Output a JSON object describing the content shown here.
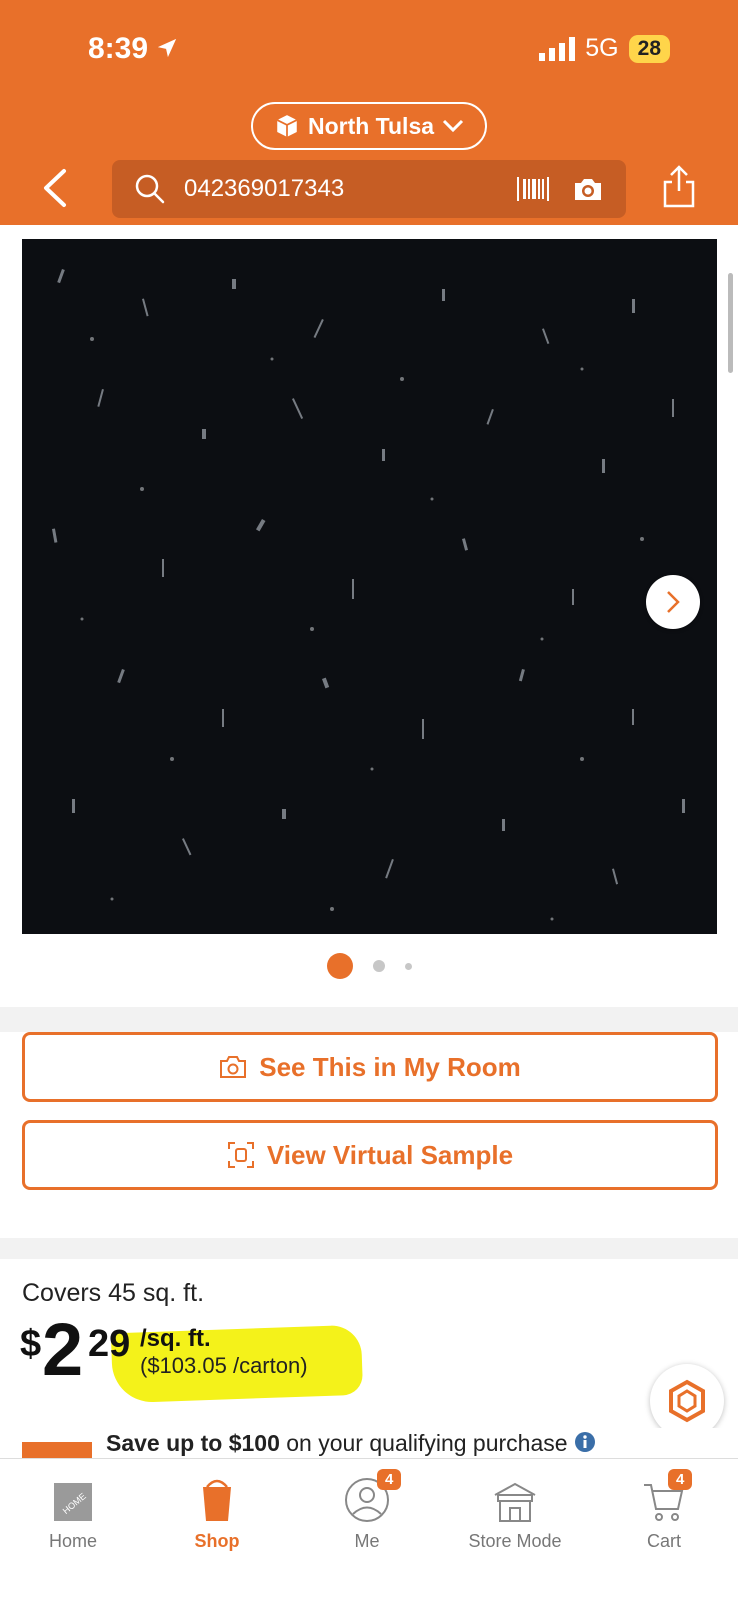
{
  "status": {
    "time": "8:39",
    "network": "5G",
    "battery": "28"
  },
  "header": {
    "store": "North Tulsa",
    "search_value": "042369017343"
  },
  "gallery": {
    "dot_count": 3,
    "active_index": 0
  },
  "actions": {
    "see_in_room": "See This in My Room",
    "virtual_sample": "View Virtual Sample"
  },
  "pricing": {
    "covers": "Covers 45 sq. ft.",
    "currency": "$",
    "dollars": "2",
    "cents": "29",
    "unit": "/sq. ft.",
    "carton": "($103.05 /carton)"
  },
  "promo": {
    "bold": "Save up to $100",
    "rest": " on your qualifying purchase"
  },
  "tabs": [
    {
      "label": "Home",
      "icon": "home-depot-logo-icon"
    },
    {
      "label": "Shop",
      "icon": "shop-bucket-icon",
      "active": true
    },
    {
      "label": "Me",
      "icon": "person-icon",
      "badge": "4"
    },
    {
      "label": "Store Mode",
      "icon": "store-icon"
    },
    {
      "label": "Cart",
      "icon": "cart-icon",
      "badge": "4"
    }
  ],
  "colors": {
    "brand": "#e8702a",
    "search_bg": "#c65d24",
    "highlight": "#f4f21a"
  }
}
